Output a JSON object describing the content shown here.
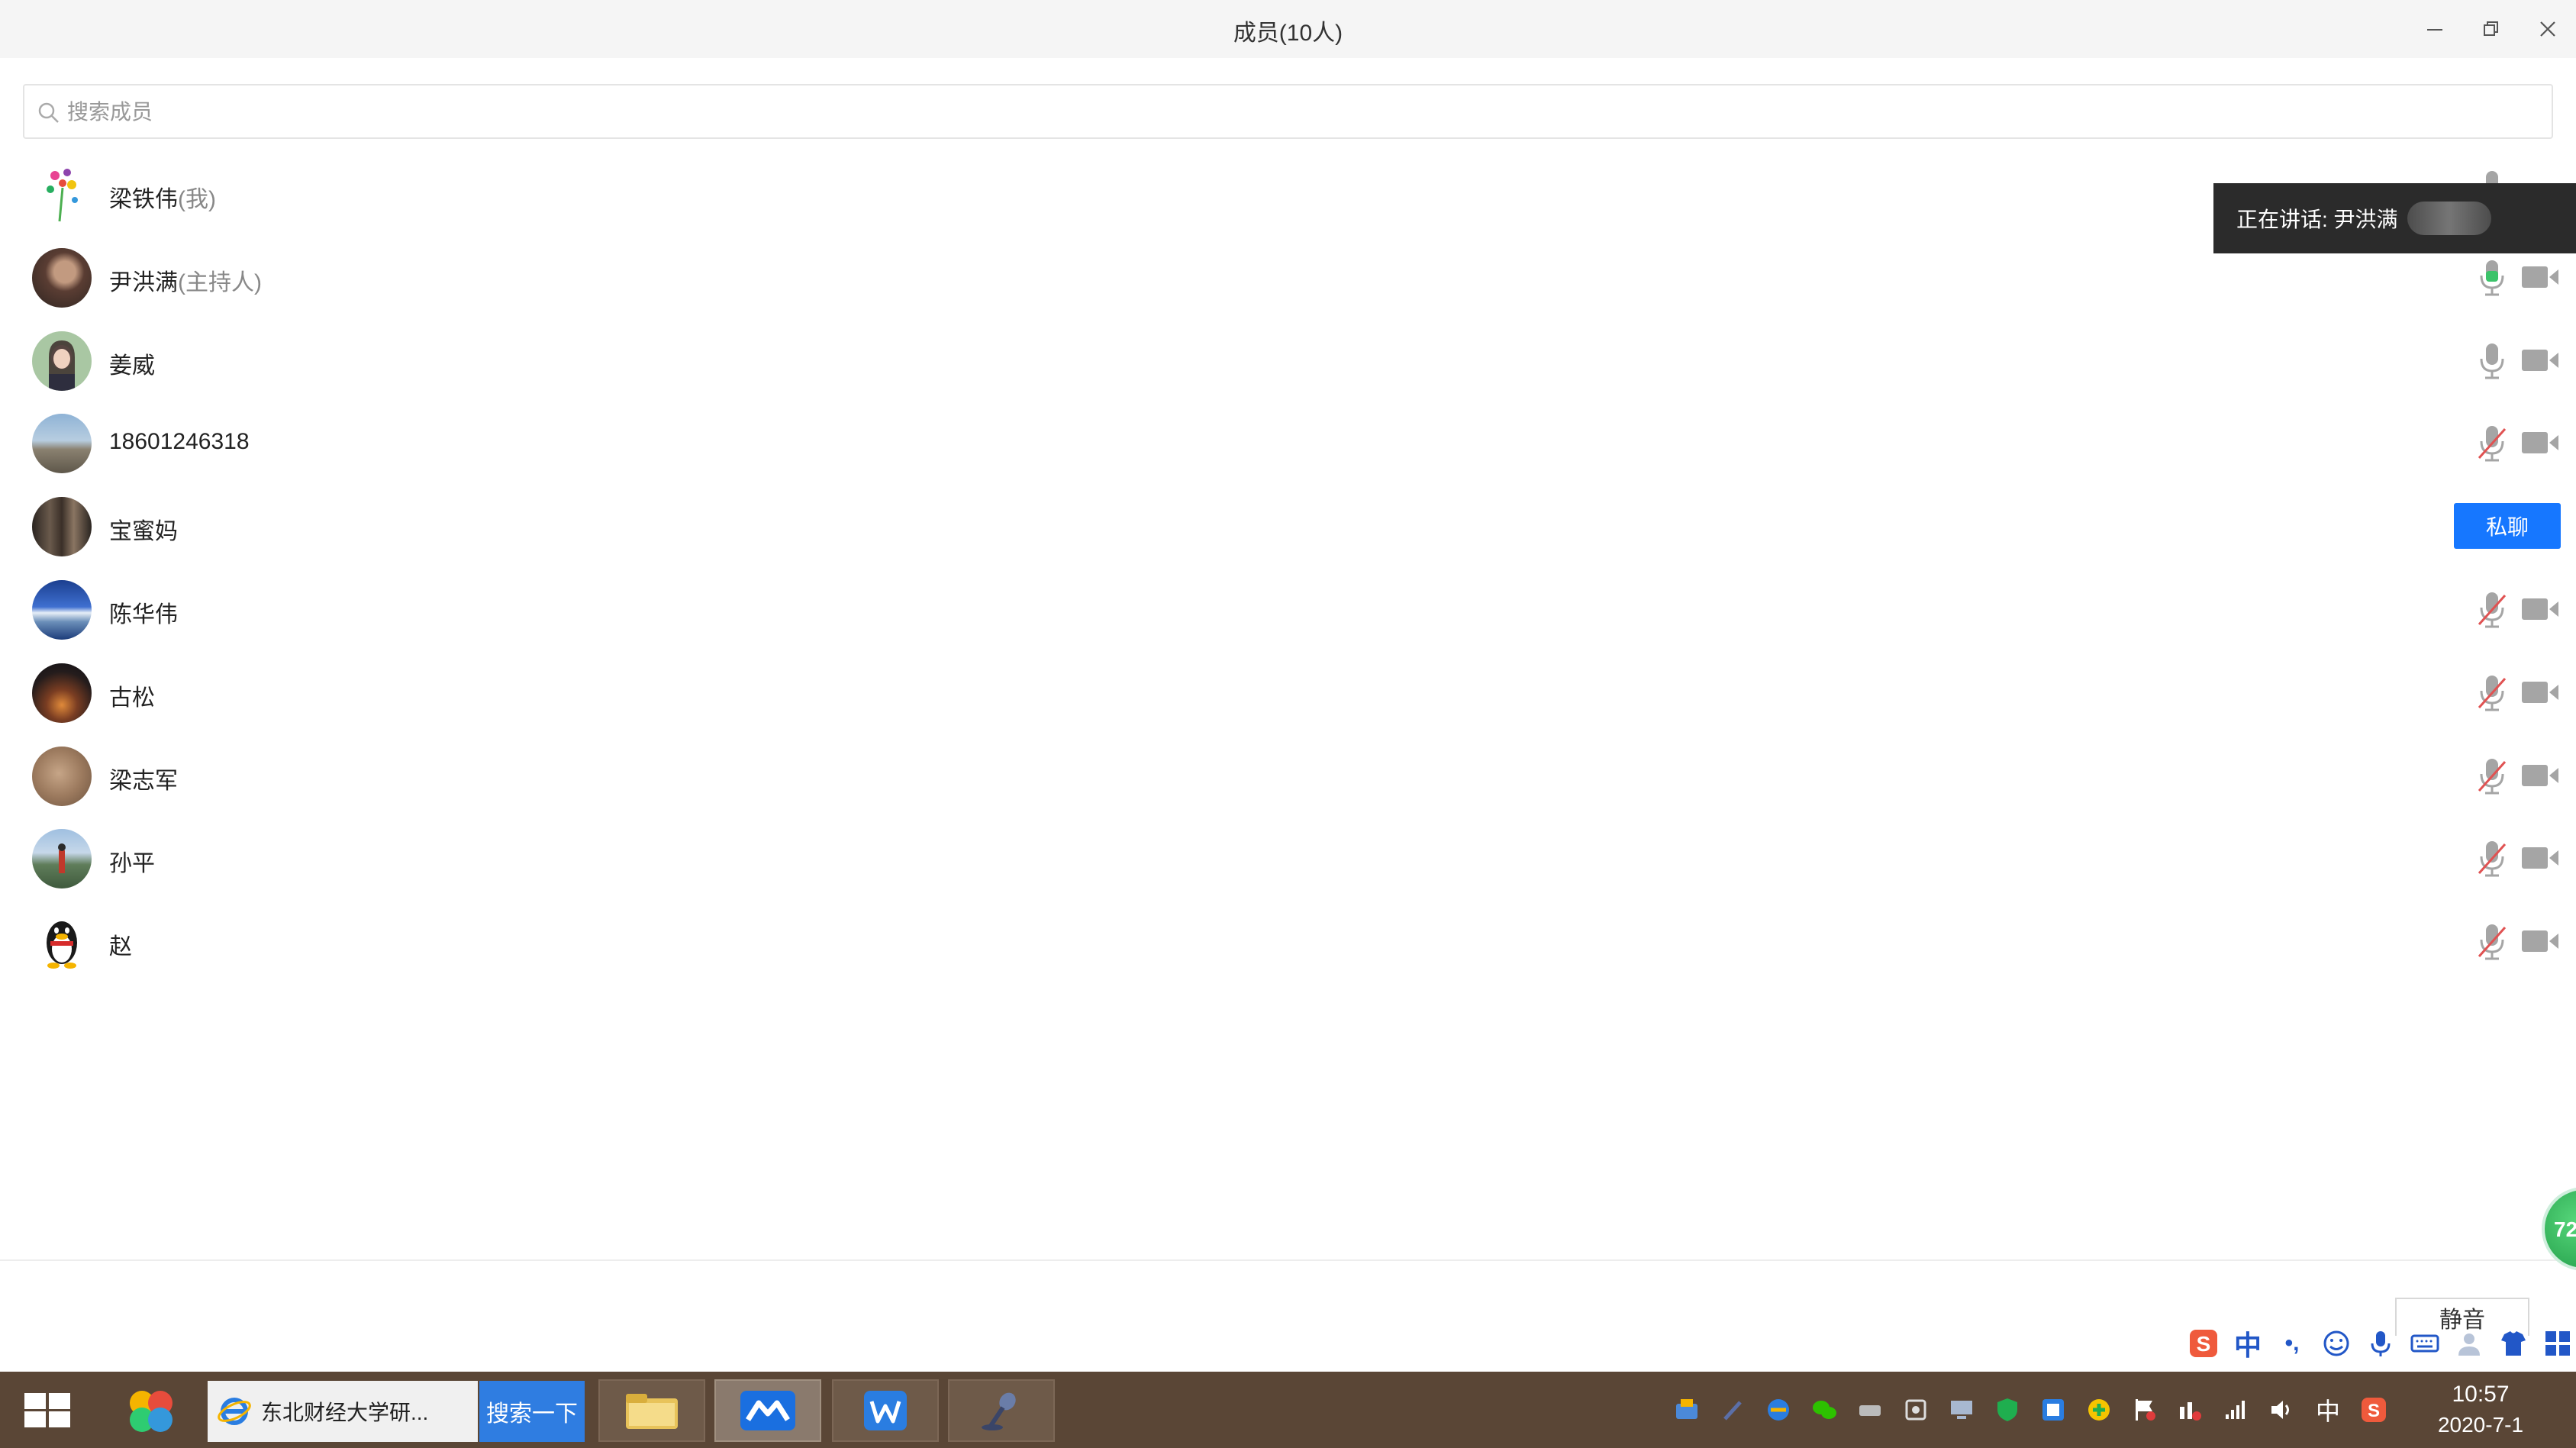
{
  "window": {
    "title": "成员(10人)"
  },
  "search": {
    "placeholder": "搜索成员"
  },
  "speaking_banner": {
    "label": "正在讲话: 尹洪满"
  },
  "members": [
    {
      "name": "梁铁伟",
      "tag": "(我)",
      "mic": "on",
      "camera": "hidden",
      "avatar": "flower"
    },
    {
      "name": "尹洪满",
      "tag": "(主持人)",
      "mic": "on-green",
      "camera": "off",
      "avatar": "person-dark"
    },
    {
      "name": "姜威",
      "tag": "",
      "mic": "on",
      "camera": "off",
      "avatar": "girl"
    },
    {
      "name": "18601246318",
      "tag": "",
      "mic": "muted",
      "camera": "off",
      "avatar": "landscape"
    },
    {
      "name": "宝蜜妈",
      "tag": "",
      "mic": "none",
      "camera": "none",
      "avatar": "silhouette",
      "action": "私聊"
    },
    {
      "name": "陈华伟",
      "tag": "",
      "mic": "muted",
      "camera": "off",
      "avatar": "blue-sky"
    },
    {
      "name": "古松",
      "tag": "",
      "mic": "muted",
      "camera": "off",
      "avatar": "sunset"
    },
    {
      "name": "梁志军",
      "tag": "",
      "mic": "muted",
      "camera": "off",
      "avatar": "brown"
    },
    {
      "name": "孙平",
      "tag": "",
      "mic": "muted",
      "camera": "off",
      "avatar": "lake"
    },
    {
      "name": "赵",
      "tag": "",
      "mic": "muted",
      "camera": "off",
      "avatar": "penguin"
    }
  ],
  "bottom": {
    "mute_label": "静音",
    "badge_text": "72"
  },
  "ime": {
    "mode": "中",
    "punct": "•,"
  },
  "taskbar": {
    "browser_title": "东北财经大学研...",
    "search_button": "搜索一下",
    "input_lang": "中",
    "time": "10:57",
    "date": "2020-7-1"
  },
  "colors": {
    "accent": "#1677ff",
    "mic_green": "#3cc36a",
    "muted_red": "#e05252",
    "icon_gray": "#a5a5a5",
    "taskbar": "#5a4636"
  }
}
